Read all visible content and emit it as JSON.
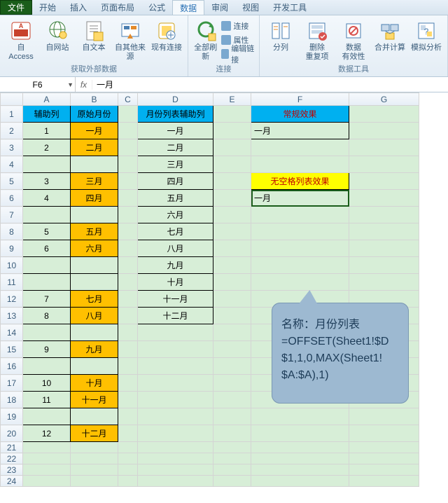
{
  "menu": {
    "file": "文件",
    "tabs": [
      "开始",
      "插入",
      "页面布局",
      "公式",
      "数据",
      "审阅",
      "视图",
      "开发工具"
    ],
    "active_index": 4
  },
  "ribbon": {
    "groups": {
      "external": {
        "label": "获取外部数据",
        "buttons": [
          "自 Access",
          "自网站",
          "自文本",
          "自其他来源",
          "现有连接"
        ]
      },
      "connections": {
        "label": "连接",
        "refresh": "全部刷新",
        "items": [
          "连接",
          "属性",
          "编辑链接"
        ]
      },
      "datatools": {
        "label": "数据工具",
        "buttons": [
          "分列",
          "删除\n重复项",
          "数据\n有效性",
          "合并计算",
          "模拟分析"
        ]
      }
    }
  },
  "formula_bar": {
    "namebox": "F6",
    "fx_label": "fx",
    "content": "一月"
  },
  "columns": [
    "A",
    "B",
    "C",
    "D",
    "E",
    "F",
    "G"
  ],
  "headers": {
    "A": "辅助列",
    "B": "原始月份",
    "D": "月份列表辅助列",
    "F_normal": "常规效果",
    "F_noblank": "无空格列表效果"
  },
  "col_A": {
    "1": "1",
    "2": "2",
    "4": "3",
    "5": "4",
    "7": "5",
    "8": "6",
    "11": "7",
    "12": "8",
    "14": "9",
    "16": "10",
    "17": "11",
    "19": "12"
  },
  "col_B": {
    "1": "一月",
    "2": "二月",
    "4": "三月",
    "5": "四月",
    "7": "五月",
    "8": "六月",
    "11": "七月",
    "12": "八月",
    "14": "九月",
    "16": "十月",
    "17": "十一月",
    "19": "十二月"
  },
  "col_D": [
    "一月",
    "二月",
    "三月",
    "四月",
    "五月",
    "六月",
    "七月",
    "八月",
    "九月",
    "十月",
    "十一月",
    "十二月"
  ],
  "F2": "一月",
  "F6": "一月",
  "callout": {
    "title": "名称：月份列表",
    "formula": "=OFFSET(Sheet1!$D$1,1,0,MAX(Sheet1!$A:$A),1)"
  }
}
